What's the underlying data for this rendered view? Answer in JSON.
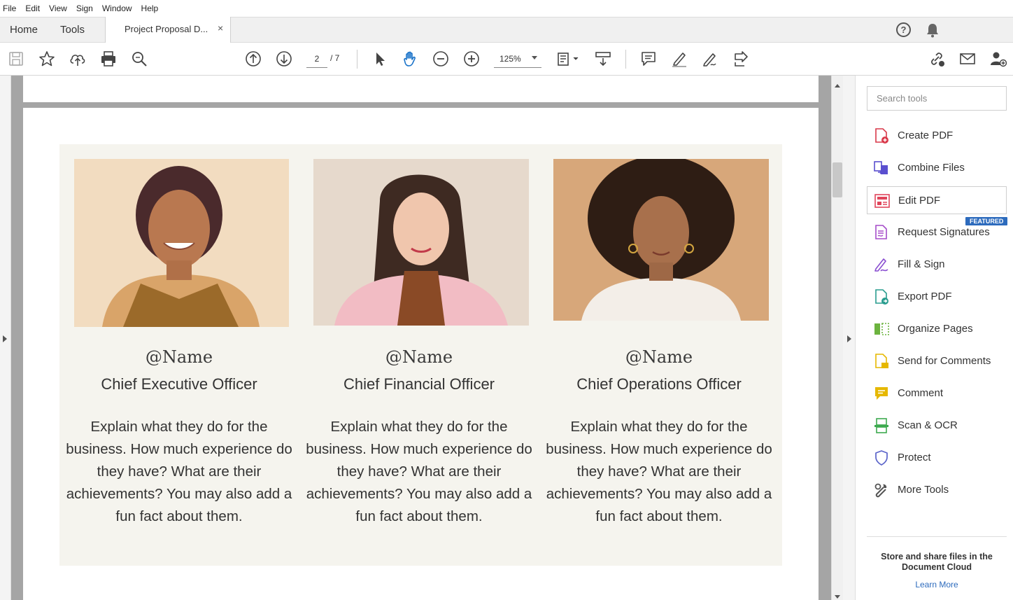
{
  "menu": [
    "File",
    "Edit",
    "View",
    "Sign",
    "Window",
    "Help"
  ],
  "tabs": {
    "home": "Home",
    "tools": "Tools",
    "document": "Project Proposal D...",
    "close": "×"
  },
  "header_icons": {
    "help": "?"
  },
  "toolbar": {
    "page_current": "2",
    "page_total": "/ 7",
    "zoom": "125%"
  },
  "team": [
    {
      "handle": "@Name",
      "role": "Chief Executive Officer",
      "description": "Explain what they do for the business. How much experience do they have? What are their achievements? You may also add a fun fact about them."
    },
    {
      "handle": "@Name",
      "role": "Chief Financial Officer",
      "description": "Explain what they do for the business. How much experience do they have? What are their achievements? You may also add a fun fact about them."
    },
    {
      "handle": "@Name",
      "role": "Chief Operations Officer",
      "description": "Explain what they do for the business. How much experience do they have? What are their achievements? You may also add a fun fact about them."
    }
  ],
  "tools_pane": {
    "search_placeholder": "Search tools",
    "items": [
      {
        "label": "Create PDF",
        "icon": "create-pdf-icon",
        "color": "#d9394a"
      },
      {
        "label": "Combine Files",
        "icon": "combine-files-icon",
        "color": "#5a4fcf"
      },
      {
        "label": "Edit PDF",
        "icon": "edit-pdf-icon",
        "color": "#e0455b"
      },
      {
        "label": "Request Signatures",
        "icon": "request-signatures-icon",
        "color": "#a54cc9"
      },
      {
        "label": "Fill & Sign",
        "icon": "fill-sign-icon",
        "color": "#8a4fd1"
      },
      {
        "label": "Export PDF",
        "icon": "export-pdf-icon",
        "color": "#2a9d8f"
      },
      {
        "label": "Organize Pages",
        "icon": "organize-pages-icon",
        "color": "#6cb33f"
      },
      {
        "label": "Send for Comments",
        "icon": "send-for-comments-icon",
        "color": "#e6b800"
      },
      {
        "label": "Comment",
        "icon": "comment-icon",
        "color": "#e6b800"
      },
      {
        "label": "Scan & OCR",
        "icon": "scan-ocr-icon",
        "color": "#3daa4f"
      },
      {
        "label": "Protect",
        "icon": "protect-icon",
        "color": "#5a63c9"
      },
      {
        "label": "More Tools",
        "icon": "more-tools-icon",
        "color": "#555555"
      }
    ],
    "featured_badge": "FEATURED",
    "cloud_title": "Store and share files in the Document Cloud",
    "cloud_link": "Learn More"
  }
}
